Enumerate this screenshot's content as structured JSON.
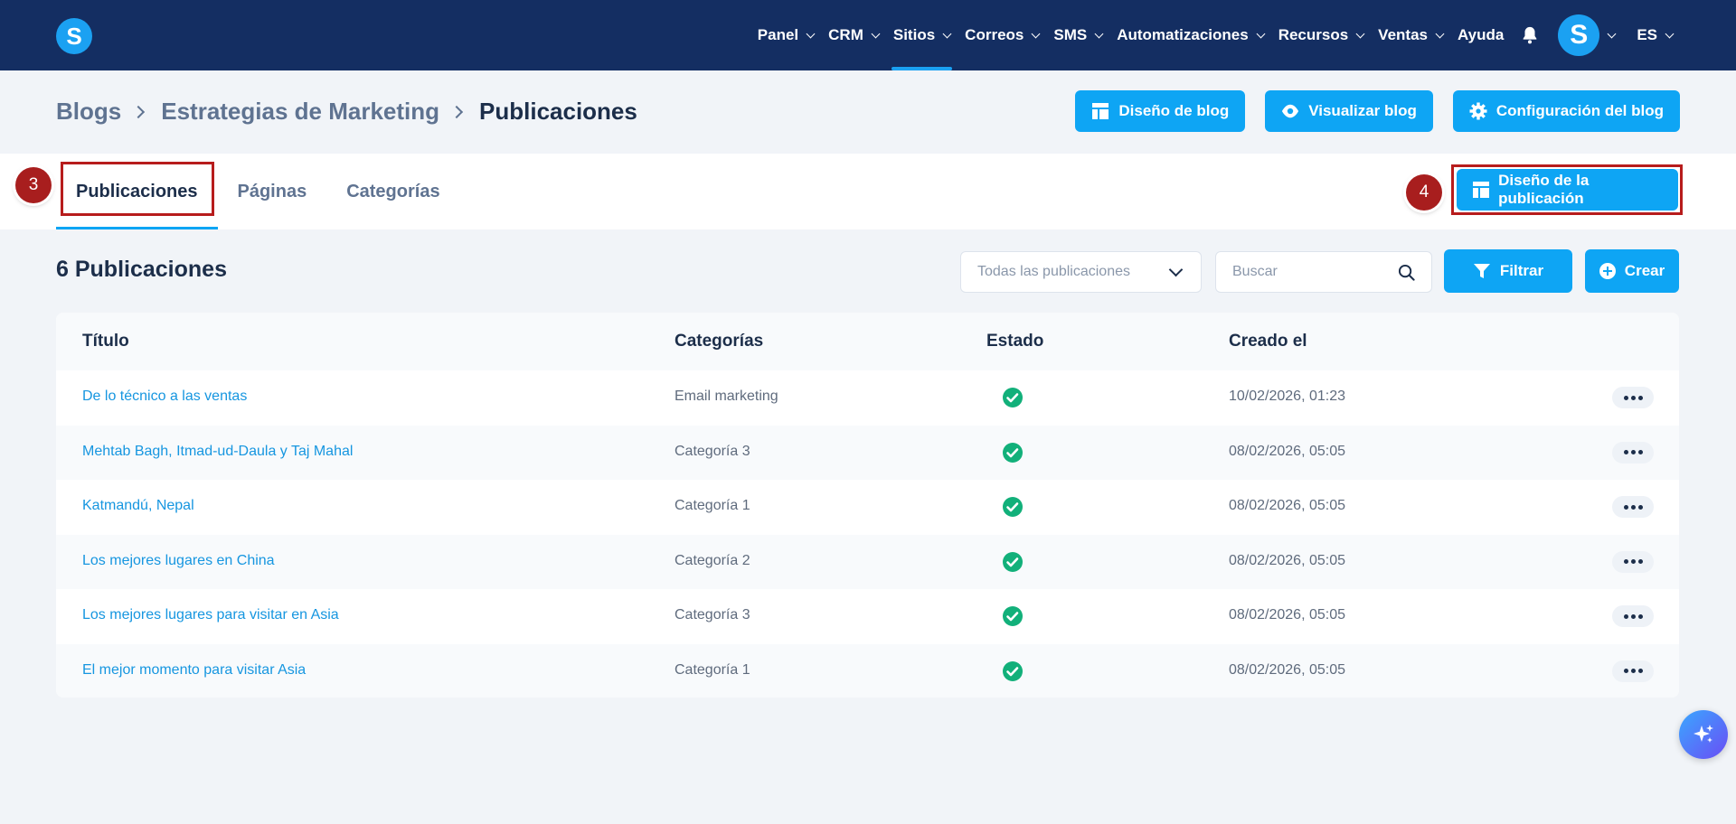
{
  "app": {
    "logo_letter": "S"
  },
  "nav": {
    "items": [
      {
        "label": "Panel"
      },
      {
        "label": "CRM"
      },
      {
        "label": "Sitios",
        "active": true
      },
      {
        "label": "Correos"
      },
      {
        "label": "SMS"
      },
      {
        "label": "Automatizaciones"
      },
      {
        "label": "Recursos"
      },
      {
        "label": "Ventas"
      }
    ],
    "help": "Ayuda",
    "avatar_letter": "S",
    "language": "ES"
  },
  "breadcrumb": [
    "Blogs",
    "Estrategias de Marketing",
    "Publicaciones"
  ],
  "header_buttons": {
    "design": "Diseño de blog",
    "view": "Visualizar blog",
    "settings": "Configuración del blog"
  },
  "tabs": [
    {
      "label": "Publicaciones",
      "active": true
    },
    {
      "label": "Páginas"
    },
    {
      "label": "Categorías"
    }
  ],
  "annotations": {
    "step3": "3",
    "step4": "4"
  },
  "post_design_button": "Diseño de la publicación",
  "list": {
    "count_number": "6",
    "count_label": "Publicaciones",
    "filter_select": "Todas las publicaciones",
    "search_placeholder": "Buscar",
    "filter_button": "Filtrar",
    "create_button": "Crear"
  },
  "table": {
    "headers": {
      "title": "Título",
      "categories": "Categorías",
      "status": "Estado",
      "created": "Creado el"
    },
    "rows": [
      {
        "title": "De lo técnico a las ventas",
        "category": "Email marketing",
        "status": "published",
        "created": "10/02/2026, 01:23"
      },
      {
        "title": "Mehtab Bagh, Itmad-ud-Daula y Taj Mahal",
        "category": "Categoría 3",
        "status": "published",
        "created": "08/02/2026, 05:05"
      },
      {
        "title": "Katmandú, Nepal",
        "category": "Categoría 1",
        "status": "published",
        "created": "08/02/2026, 05:05"
      },
      {
        "title": "Los mejores lugares en China",
        "category": "Categoría 2",
        "status": "published",
        "created": "08/02/2026, 05:05"
      },
      {
        "title": "Los mejores lugares para visitar en Asia",
        "category": "Categoría 3",
        "status": "published",
        "created": "08/02/2026, 05:05"
      },
      {
        "title": "El mejor momento para visitar Asia",
        "category": "Categoría 1",
        "status": "published",
        "created": "08/02/2026, 05:05"
      }
    ]
  },
  "colors": {
    "navbar": "#142e62",
    "accent": "#0ea5f4",
    "highlight": "#b71c1c",
    "success": "#12b07a"
  },
  "icons": {
    "bell": "bell-icon",
    "status": "check-circle-icon",
    "fab": "sparkle-icon"
  }
}
